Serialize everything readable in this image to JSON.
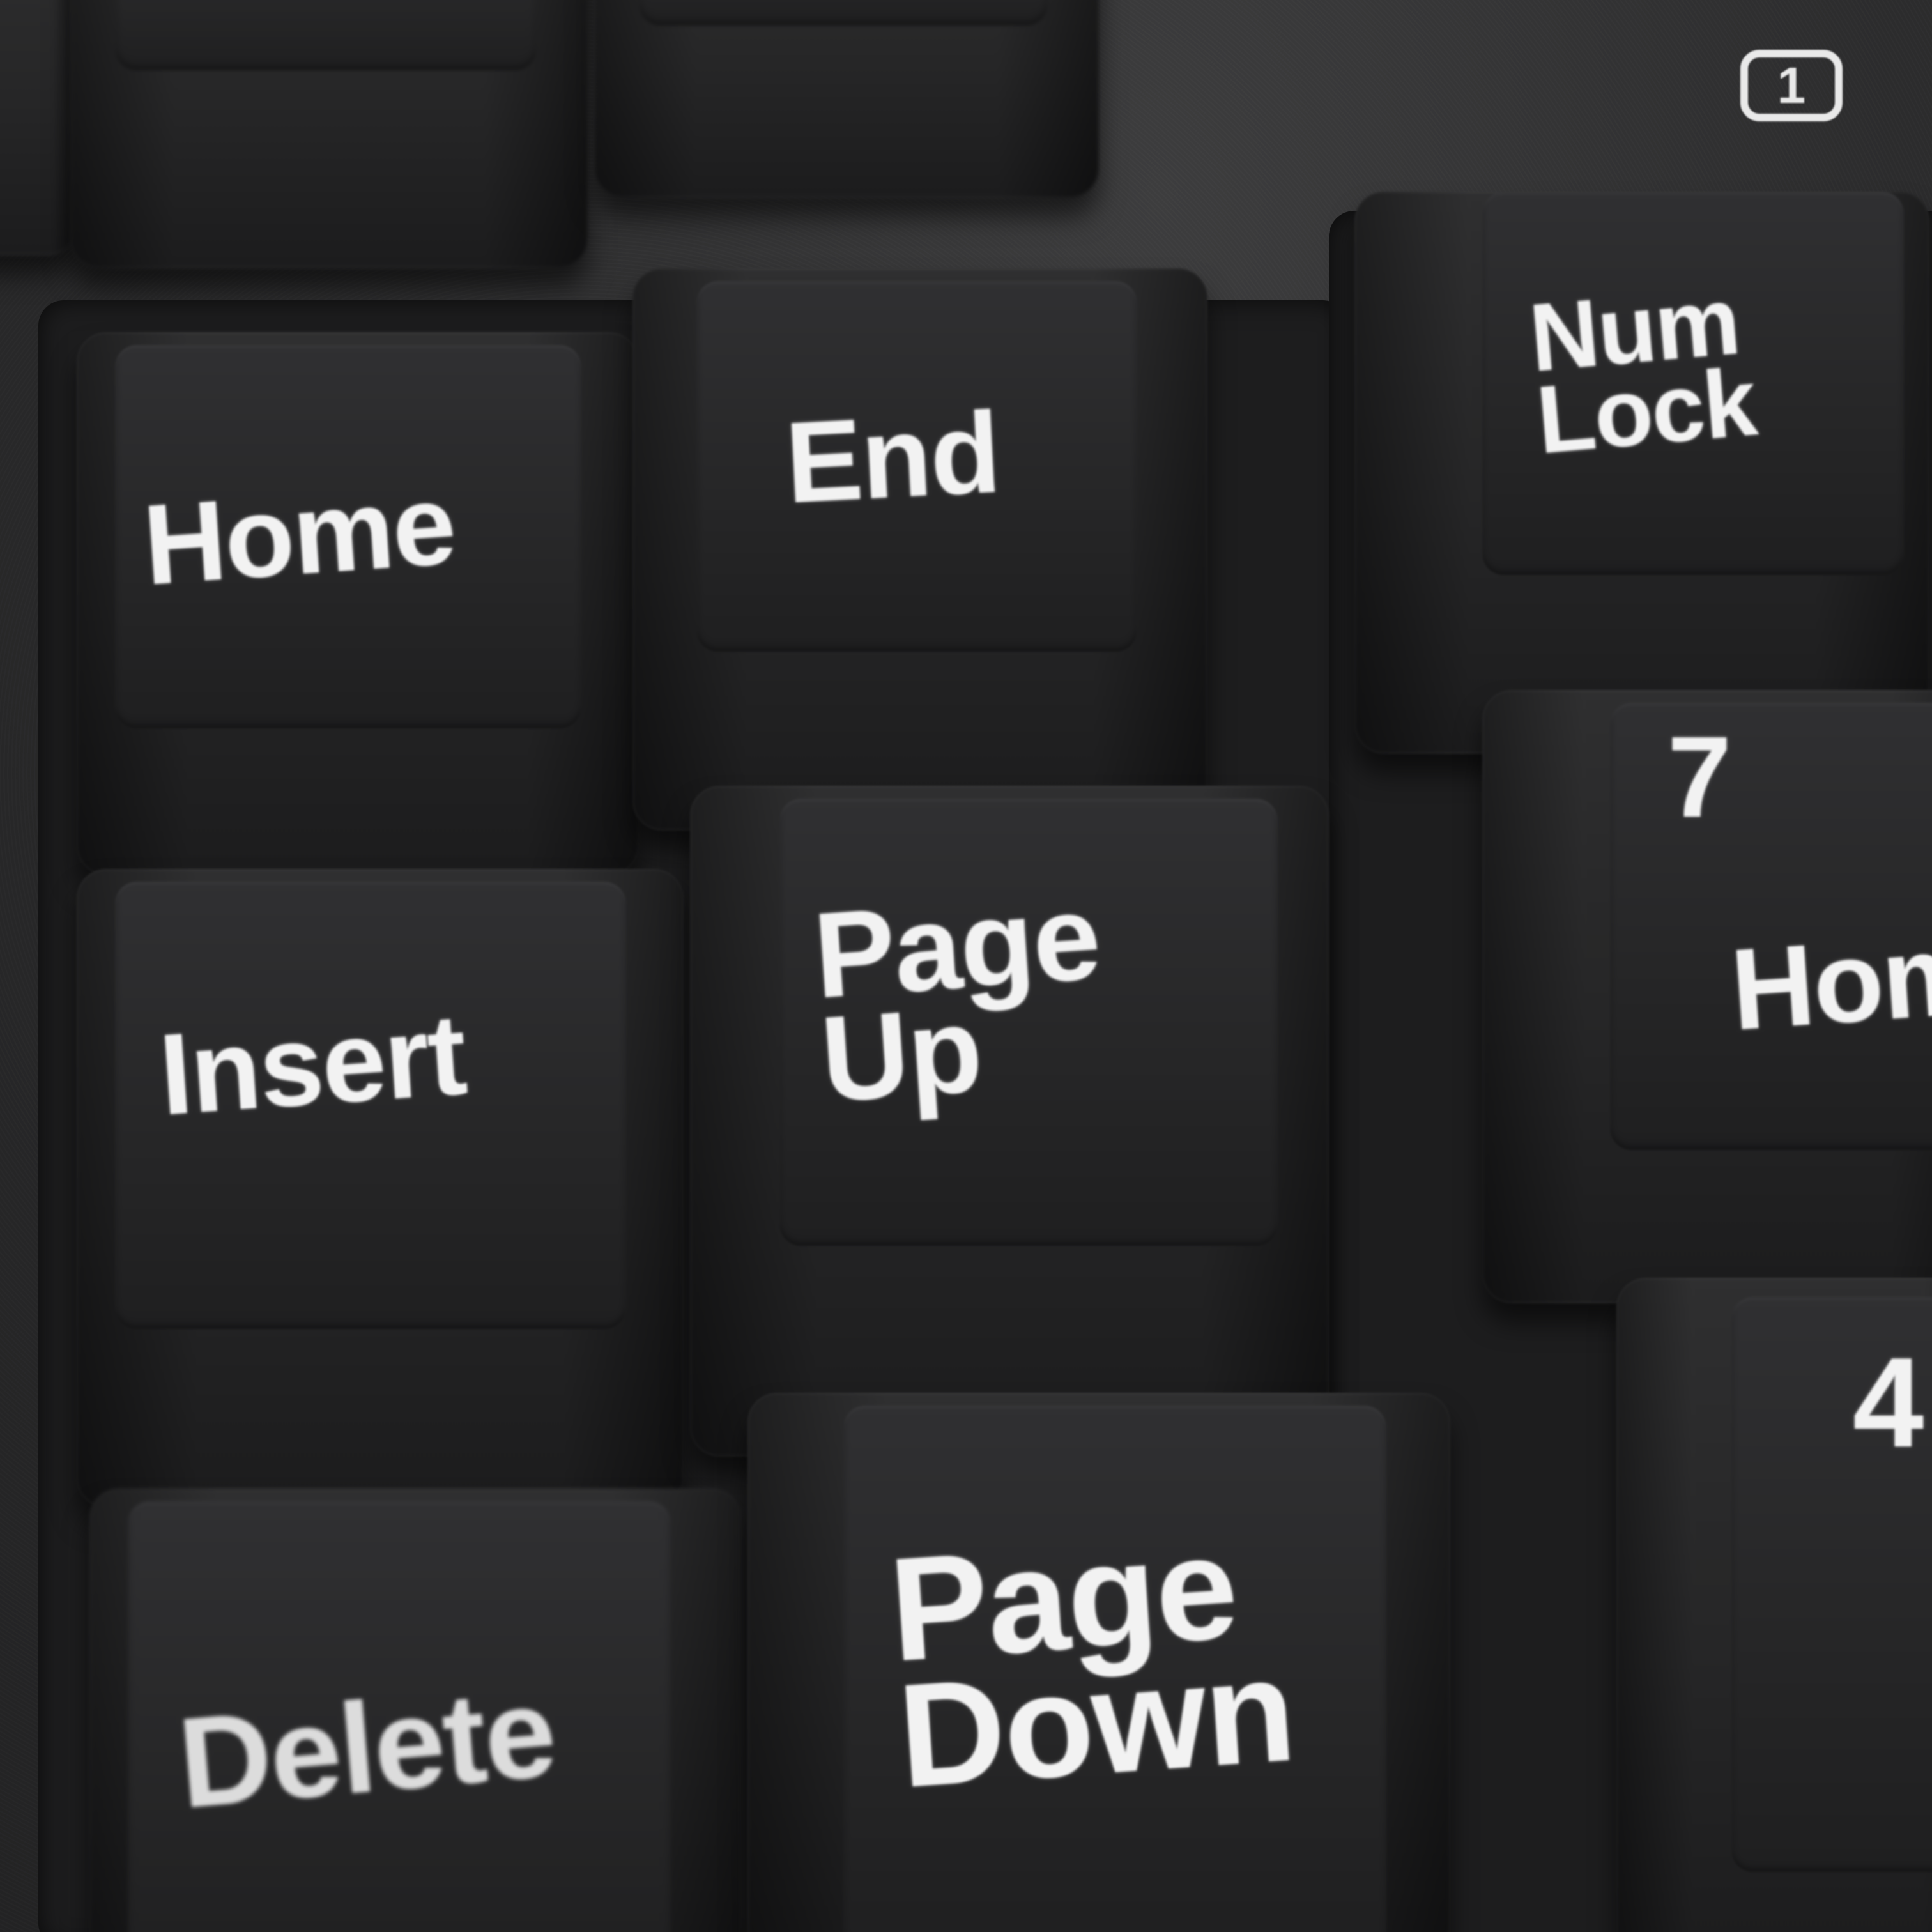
{
  "keyboard": {
    "indicator_label": "1",
    "keys": {
      "home": "Home",
      "end": "End",
      "num_lock": "Num\nLock",
      "insert": "Insert",
      "page_up": "Page\nUp",
      "seven": "7",
      "numpad_home": "Hom",
      "delete": "Delete",
      "page_down": "Page\nDown",
      "four": "4"
    }
  }
}
